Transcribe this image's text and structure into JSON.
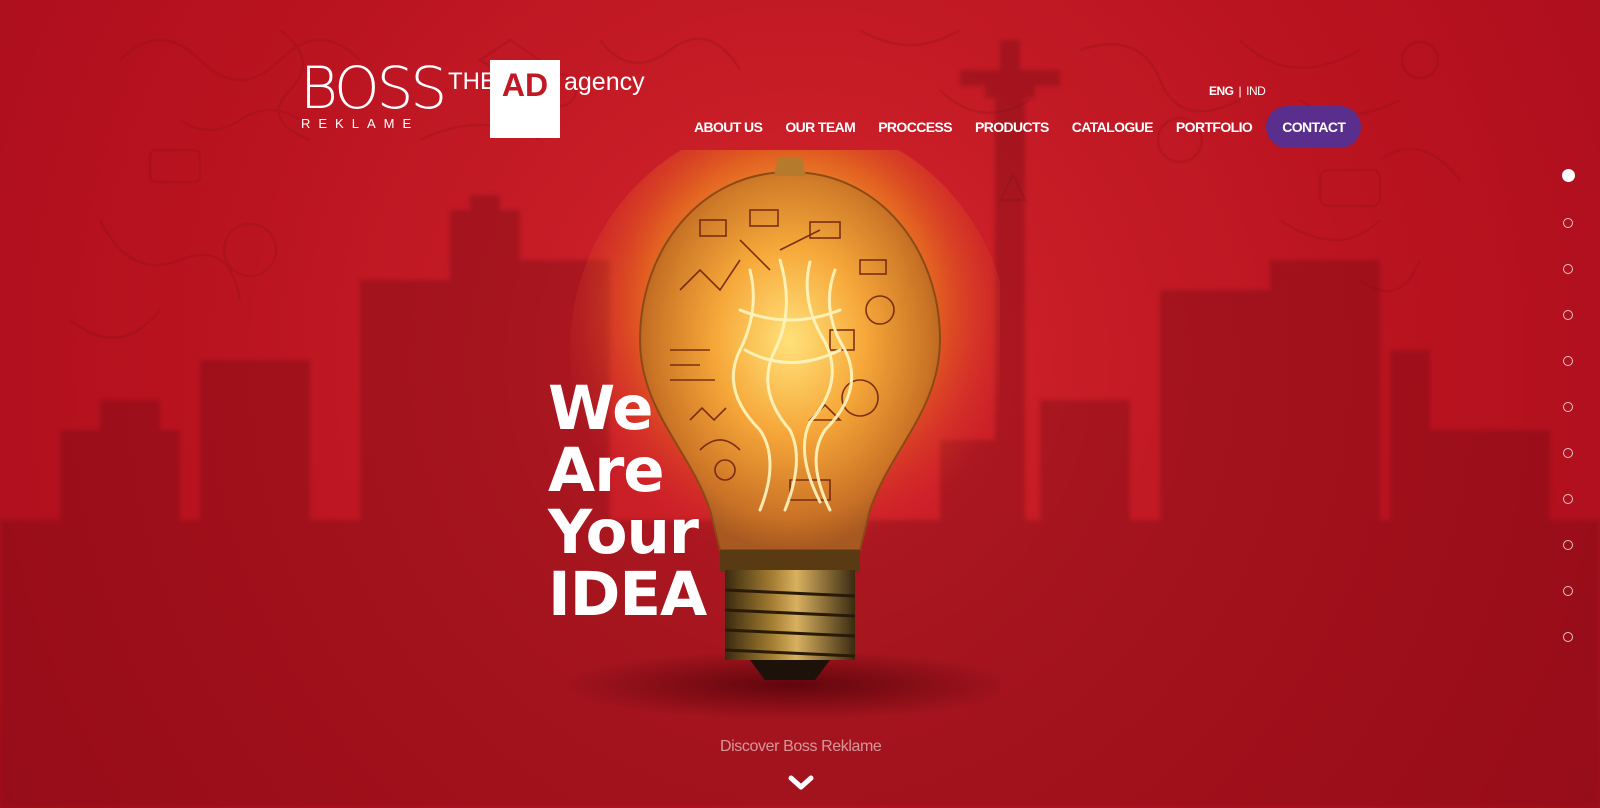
{
  "brand": {
    "logo_text": "BOSS",
    "logo_sub": "REKLAME",
    "tagline_the": "THE",
    "tagline_ad": "AD",
    "tagline_agency": "agency"
  },
  "language": {
    "eng": "ENG",
    "separator": "|",
    "ind": "IND"
  },
  "nav": {
    "items": [
      {
        "label": "ABOUT US"
      },
      {
        "label": "OUR TEAM"
      },
      {
        "label": "PROCCESS"
      },
      {
        "label": "PRODUCTS"
      },
      {
        "label": "CATALOGUE"
      },
      {
        "label": "PORTFOLIO"
      }
    ],
    "contact": "CONTACT"
  },
  "hero": {
    "line1": "We",
    "line2": "Are",
    "line3": "Your",
    "line4": "IDEA"
  },
  "discover": {
    "text": "Discover Boss Reklame",
    "icon": "chevron-down-icon"
  },
  "section_dots": {
    "count": 11,
    "active_index": 0
  },
  "colors": {
    "background": "#c01824",
    "contact_button": "#5a2e8c",
    "text": "#ffffff"
  }
}
